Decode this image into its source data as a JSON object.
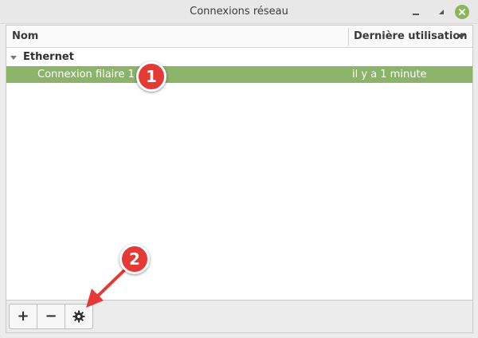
{
  "window": {
    "title": "Connexions réseau",
    "accent_color": "#8cb36a"
  },
  "columns": {
    "name": "Nom",
    "last_used": "Dernière utilisation"
  },
  "groups": [
    {
      "label": "Ethernet",
      "connections": [
        {
          "name": "Connexion filaire 1",
          "last_used": "il y a 1 minute",
          "selected": true
        }
      ]
    }
  ],
  "toolbar": {
    "add_label": "+",
    "remove_label": "−",
    "settings_icon": "gear-icon"
  },
  "annotations": [
    {
      "label": "1",
      "color": "#e53935"
    },
    {
      "label": "2",
      "color": "#e53935"
    }
  ]
}
